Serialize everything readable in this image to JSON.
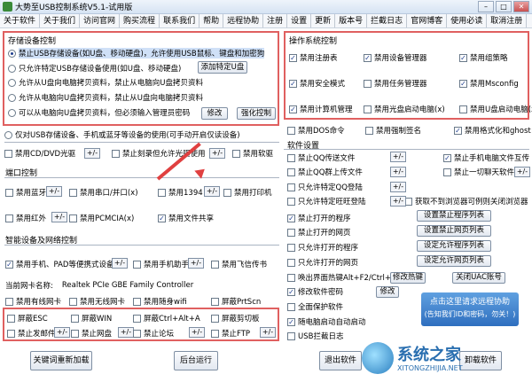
{
  "window": {
    "title": "大势至USB控制系统V5.1-试用版"
  },
  "menu": [
    "关于软件",
    "关于我们",
    "访问官网",
    "购买流程",
    "联系我们",
    "帮助",
    "远程协助",
    "注册",
    "设置",
    "更新",
    "版本号",
    "拦截日志",
    "官网博客",
    "使用必读",
    "取消注册"
  ],
  "storage": {
    "title": "存储设备控制",
    "options": [
      "禁止USB存储设备(如U盘、移动硬盘)，允许使用USB鼠标、键盘和加密狗",
      "只允许特定USB存储设备使用(如U盘、移动硬盘)",
      "允许从U盘向电脑拷贝资料，禁止从电脑向U盘拷贝资料",
      "允许从电脑向U盘拷贝资料，禁止从U盘向电脑拷贝资料",
      "可以从电脑向U盘拷贝资料，但必须输入管理员密码"
    ],
    "add_udisk": "添加特定U盘",
    "modify": "修改",
    "force_control": "强化控制"
  },
  "phone_note": "仅对USB存储设备、手机或蓝牙等设备的使用(可手动开启仅读设备)",
  "cd": {
    "cdrom": "禁用CD/DVD光驱",
    "burn": "禁止刻录但允许光驱使用",
    "softdrive": "禁用软驱"
  },
  "port": {
    "title": "端口控制",
    "items": [
      "禁用蓝牙",
      "禁用串口/并口(x)",
      "禁用1394",
      "禁用打印机",
      "禁用红外",
      "禁用PCMCIA(x)",
      "禁用文件共享"
    ]
  },
  "smart": {
    "title": "智能设备及网络控制",
    "items": [
      "禁用手机、PAD等便携式设备",
      "禁用手机助手",
      "禁用飞信传书"
    ]
  },
  "nic": {
    "label": "当前网卡名称:",
    "value": "Realtek PCIe GBE Family Controller"
  },
  "nic_items": [
    "禁用有线网卡",
    "禁用无线网卡",
    "禁用随身wifi",
    "屏蔽PrtScn"
  ],
  "hotkeys": [
    "屏蔽ESC",
    "屏蔽WIN",
    "屏蔽Ctrl+Alt+A",
    "屏蔽剪切板",
    "禁止发邮件",
    "禁止网盘",
    "禁止论坛",
    "禁止FTP"
  ],
  "os": {
    "title": "操作系统控制",
    "items": [
      "禁用注册表",
      "禁用设备管理器",
      "禁用组策略",
      "禁用安全模式",
      "禁用任务管理器",
      "禁用Msconfig",
      "禁用计算机管理",
      "禁用光盘启动电脑(x)",
      "禁用U盘启动电脑(x)"
    ],
    "extra": [
      "禁用DOS命令",
      "禁用强制签名",
      "禁用格式化和ghost"
    ]
  },
  "software": {
    "title": "软件设置",
    "left": [
      "禁止QQ传送文件",
      "禁止QQ群上传文件",
      "只允许特定QQ登陆",
      "只允许特定旺旺登陆",
      "禁止打开的程序",
      "禁止打开的网页",
      "只允许打开的程序",
      "只允许打开的网页",
      "唤出界面热键Alt+F2/Ctrl+Alt+2",
      "修改软件密码",
      "全面保护软件",
      "随电脑启动自动启动",
      "USB拦截日志"
    ],
    "right": [
      "禁止手机电脑文件互传",
      "禁止一切聊天软件",
      "获取不到浏览器可例则关闭浏览器"
    ],
    "buttons": [
      "设置禁止程序列表",
      "设置禁止网页列表",
      "设定允许程序列表",
      "设定允许网页列表"
    ],
    "modify_hotkey": "修改热键",
    "modify_pwd": "修改",
    "close_uac": "关闭UAC账号",
    "remote": "点击这里请求远程协助\n(告知我们ID和密码，勿关！)"
  },
  "bottom": {
    "reload": "关键词重新加载",
    "background": "后台运行",
    "exit": "退出软件",
    "uninstall": "卸载软件"
  },
  "watermark": {
    "cn": "系统之家",
    "en": "XITONGZHIJIA.NET"
  }
}
